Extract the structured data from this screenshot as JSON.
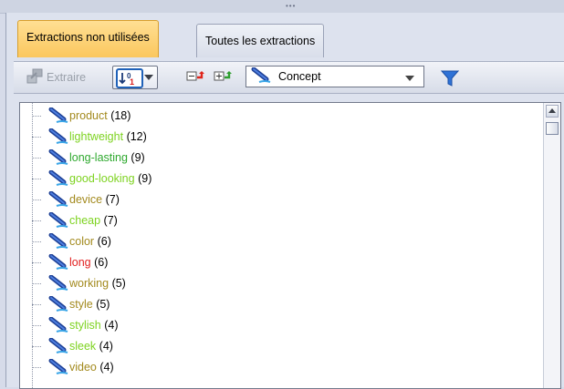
{
  "tabs": [
    {
      "label": "Extractions non utilisées",
      "active": true
    },
    {
      "label": "Toutes les extractions",
      "active": false
    }
  ],
  "toolbar": {
    "extract_label": "Extraire",
    "sort_value": "1",
    "type_select": "Concept"
  },
  "colors": {
    "olive": "#a38a1e",
    "light_green": "#7ed321",
    "green": "#2fa92f",
    "red": "#e21f1f",
    "tab_active": "#fbc75e",
    "filter_blue": "#2f72d6"
  },
  "concepts": [
    {
      "term": "product",
      "count": "(18)",
      "color": "#a38a1e"
    },
    {
      "term": "lightweight",
      "count": "(12)",
      "color": "#7ed321"
    },
    {
      "term": "long-lasting",
      "count": "(9)",
      "color": "#2fa92f"
    },
    {
      "term": "good-looking",
      "count": "(9)",
      "color": "#7ed321"
    },
    {
      "term": "device",
      "count": "(7)",
      "color": "#a38a1e"
    },
    {
      "term": "cheap",
      "count": "(7)",
      "color": "#7ed321"
    },
    {
      "term": "color",
      "count": "(6)",
      "color": "#a38a1e"
    },
    {
      "term": "long",
      "count": "(6)",
      "color": "#e21f1f"
    },
    {
      "term": "working",
      "count": "(5)",
      "color": "#a38a1e"
    },
    {
      "term": "style",
      "count": "(5)",
      "color": "#a38a1e"
    },
    {
      "term": "stylish",
      "count": "(4)",
      "color": "#7ed321"
    },
    {
      "term": "sleek",
      "count": "(4)",
      "color": "#7ed321"
    },
    {
      "term": "video",
      "count": "(4)",
      "color": "#a38a1e"
    }
  ]
}
